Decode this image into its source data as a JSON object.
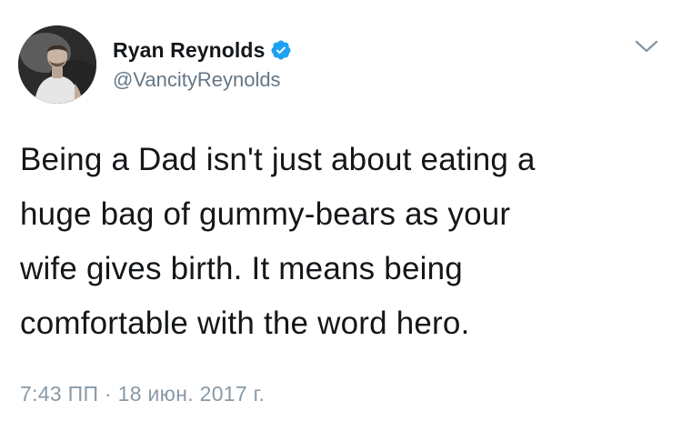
{
  "author": {
    "display_name": "Ryan Reynolds",
    "handle": "@VancityReynolds",
    "verified": true,
    "avatar_icon": "profile-photo"
  },
  "tweet": {
    "text_lines": [
      "Being a Dad isn't just about eating a",
      "huge bag of gummy-bears as your",
      "wife gives birth. It means being",
      "comfortable with the word hero."
    ],
    "timestamp": "7:43 ПП · 18 июн. 2017 г."
  },
  "icons": {
    "verified": "verified-badge-icon",
    "menu": "chevron-down-icon"
  },
  "colors": {
    "verified_blue": "#1da1f2",
    "secondary_text": "#657786",
    "meta_text": "#8899a6",
    "primary_text": "#14171a"
  }
}
